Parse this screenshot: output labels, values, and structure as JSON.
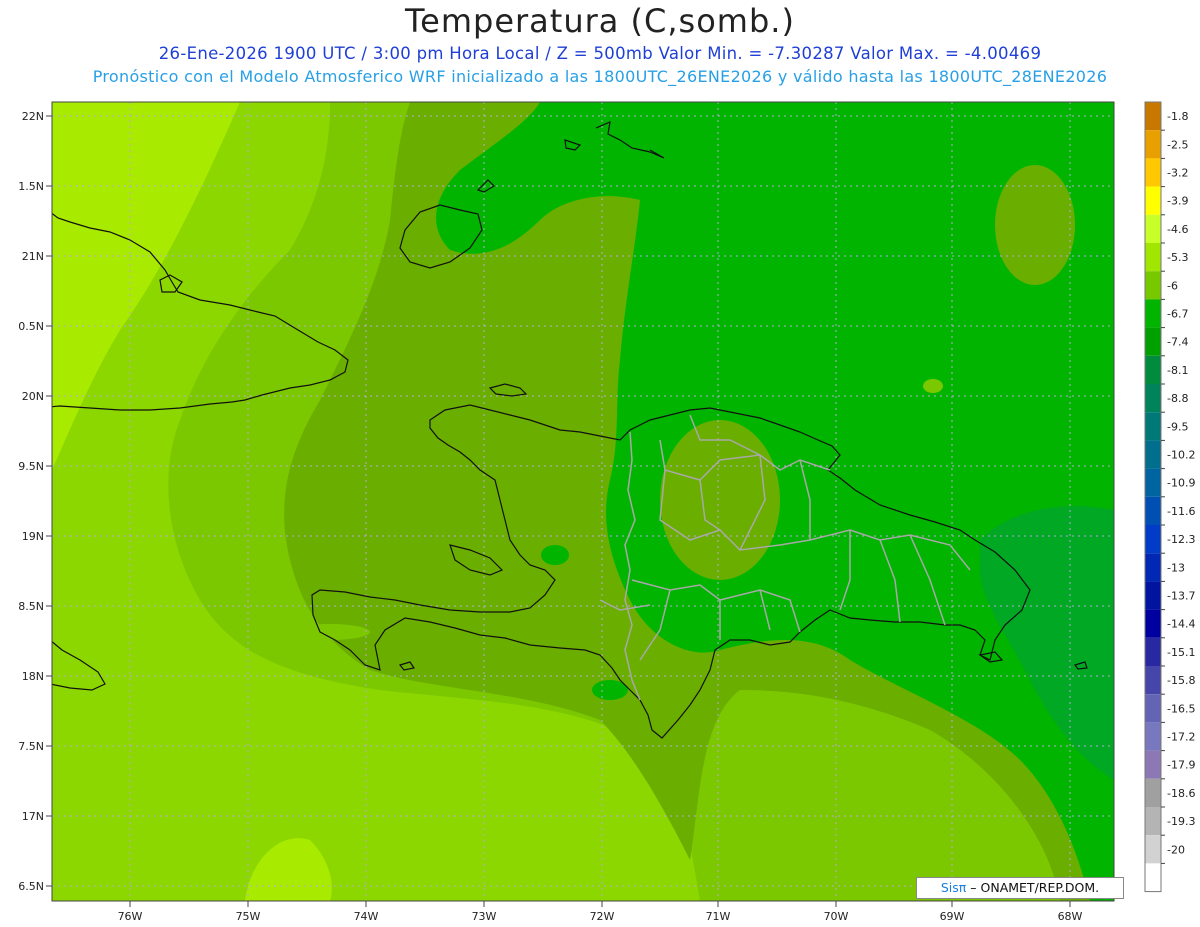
{
  "header": {
    "title": "Temperatura (C,somb.)",
    "subtitle": "26-Ene-2026  1900 UTC / 3:00 pm Hora Local / Z = 500mb  Valor Min. = -7.30287  Valor Max. = -4.00469",
    "forecast_note": "Pronóstico con el Modelo Atmosferico WRF inicializado a las 1800UTC_26ENE2026 y válido hasta las  1800UTC_28ENE2026"
  },
  "axes": {
    "lat_labels": [
      "22N",
      "1.5N",
      "21N",
      "0.5N",
      "20N",
      "9.5N",
      "19N",
      "8.5N",
      "18N",
      "7.5N",
      "17N",
      "6.5N"
    ],
    "lon_labels": [
      "76W",
      "75W",
      "74W",
      "73W",
      "72W",
      "71W",
      "70W",
      "69W",
      "68W"
    ]
  },
  "colorbar": {
    "labels": [
      "-1.8",
      "-2.5",
      "-3.2",
      "-3.9",
      "-4.6",
      "-5.3",
      "-6",
      "-6.7",
      "-7.4",
      "-8.1",
      "-8.8",
      "-9.5",
      "-10.2",
      "-10.9",
      "-11.6",
      "-12.3",
      "-13",
      "-13.7",
      "-14.4",
      "-15.1",
      "-15.8",
      "-16.5",
      "-17.2",
      "-17.9",
      "-18.6",
      "-19.3",
      "-20"
    ],
    "colors": [
      "#c87800",
      "#e8a000",
      "#ffc800",
      "#ffff00",
      "#c8ff28",
      "#a0e600",
      "#78c800",
      "#00b400",
      "#00a000",
      "#008c3c",
      "#00825a",
      "#007878",
      "#006e8c",
      "#0064a0",
      "#0050b4",
      "#003cc8",
      "#0028b4",
      "#0014a0",
      "#0000a0",
      "#2828a0",
      "#4646aa",
      "#6464b4",
      "#7878be",
      "#8c78b4",
      "#a0a0a0",
      "#b4b4b4",
      "#d2d2d2",
      "#ffffff"
    ]
  },
  "map_colors": {
    "light": "#8cd700",
    "mid_light": "#7cc800",
    "mid": "#6aae00",
    "dark": "#00b400",
    "brighter": "#b4f000"
  },
  "credit": {
    "brand": "Sisπ",
    "text": "– ONAMET/REP.DOM."
  }
}
